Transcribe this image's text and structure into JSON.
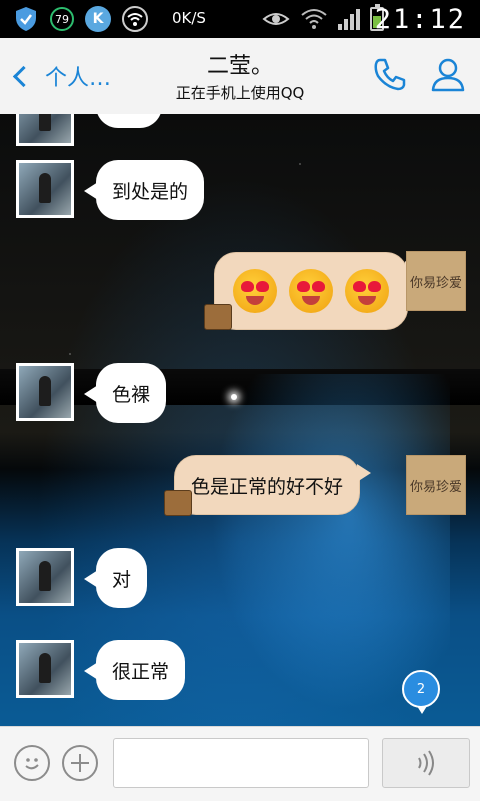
{
  "status": {
    "battery_level_text": "79",
    "net_speed": "0K/S",
    "time": "21:12",
    "battery_fill_fraction": 0.6,
    "icons": [
      "shield-icon",
      "battery-saver-icon",
      "k-icon",
      "wifi-icon",
      "eye-icon",
      "wifi-icon",
      "signal-icon",
      "battery-icon"
    ]
  },
  "header": {
    "back_label": "个人…",
    "title": "二莹。",
    "subtitle": "正在手机上使用QQ"
  },
  "chat": {
    "messages": [
      {
        "side": "left",
        "text": "到处是的"
      },
      {
        "side": "right",
        "type": "emoji",
        "emoji": [
          "heart-eyes",
          "heart-eyes",
          "heart-eyes"
        ]
      },
      {
        "side": "left",
        "text": "色裸"
      },
      {
        "side": "right",
        "text": "色是正常的好不好"
      },
      {
        "side": "left",
        "text": "对"
      },
      {
        "side": "left",
        "text": "很正常"
      }
    ],
    "self_avatar_text": "你易珍爱",
    "new_message_count": "2"
  },
  "colors": {
    "accent": "#1a84d6",
    "right_bubble": "#f2d8bd",
    "left_bubble": "#ffffff"
  }
}
